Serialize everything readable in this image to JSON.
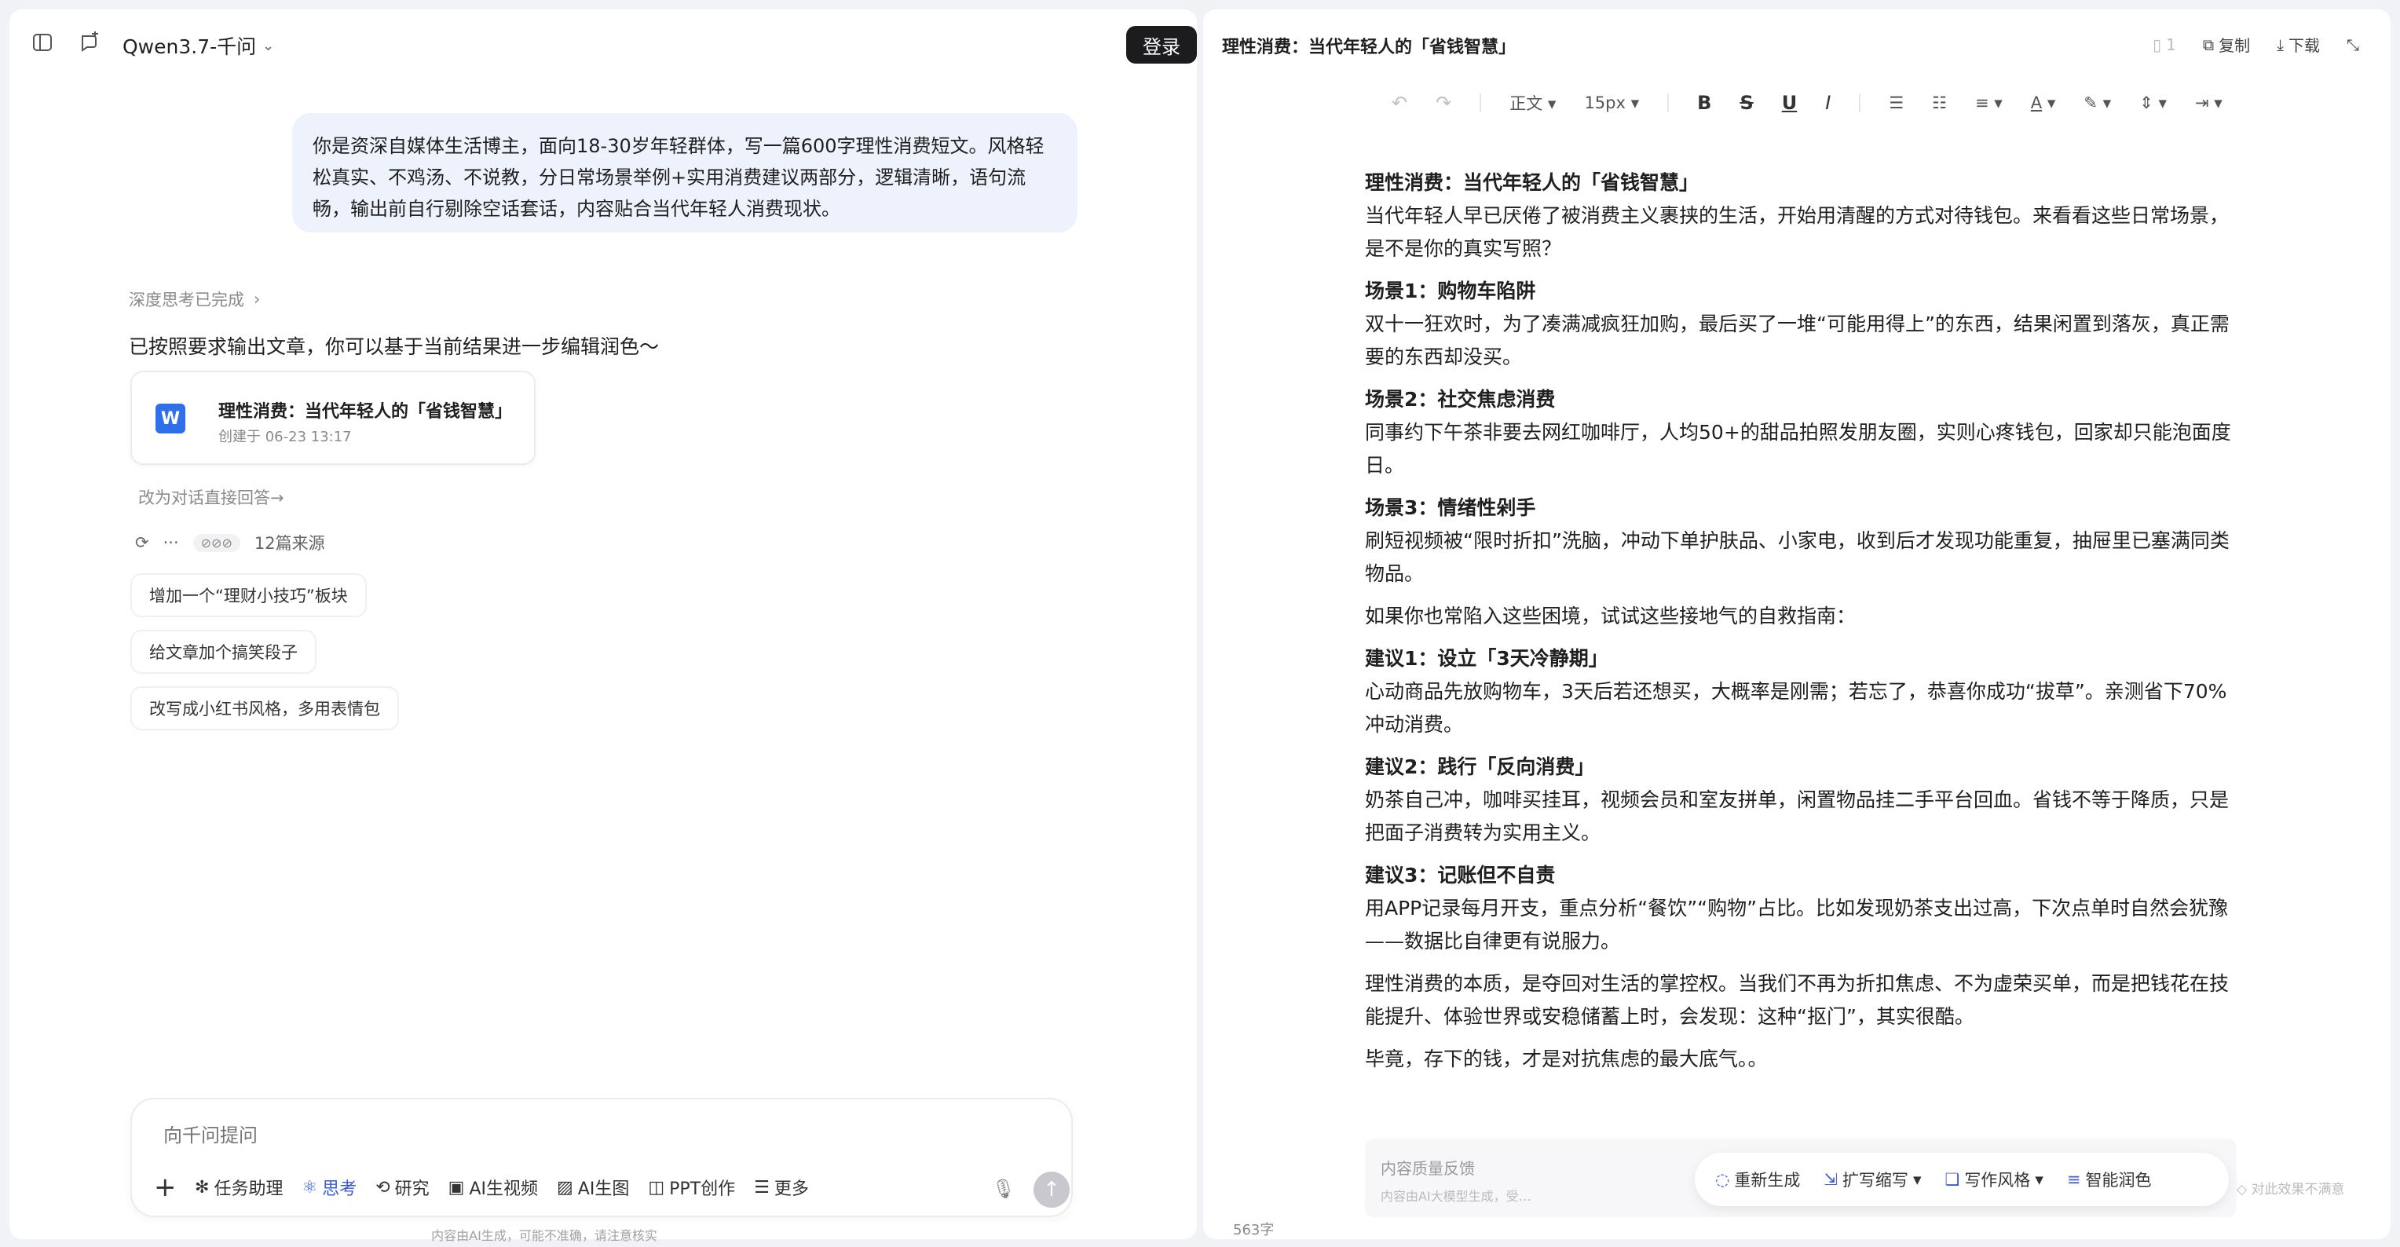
{
  "left": {
    "model_name": "Qwen3.7-千问",
    "login_label": "登录",
    "user_message": "你是资深自媒体生活博主，面向18-30岁年轻群体，写一篇600字理性消费短文。风格轻松真实、不鸡汤、不说教，分日常场景举例+实用消费建议两部分，逻辑清晰，语句流畅，输出前自行剔除空话套话，内容贴合当代年轻人消费现状。",
    "think_status": "深度思考已完成",
    "reply_text": "已按照要求输出文章，你可以基于当前结果进一步编辑润色～",
    "doc_card": {
      "icon_letter": "W",
      "title": "理性消费：当代年轻人的「省钱智慧」",
      "created": "创建于 06-23 13:17"
    },
    "switch_link": "改为对话直接回答→",
    "sources_label": "12篇来源",
    "more_label": "···",
    "suggestions": [
      "增加一个“理财小技巧”板块",
      "给文章加个搞笑段子",
      "改写成小红书风格，多用表情包"
    ],
    "composer": {
      "placeholder": "向千问提问",
      "tools": [
        {
          "label": "任务助理",
          "icon": "✻"
        },
        {
          "label": "思考",
          "icon": "⚛"
        },
        {
          "label": "研究",
          "icon": "⟲"
        },
        {
          "label": "AI生视频",
          "icon": "▣"
        },
        {
          "label": "AI生图",
          "icon": "▨"
        },
        {
          "label": "PPT创作",
          "icon": "◫"
        },
        {
          "label": "更多",
          "icon": "☰"
        }
      ]
    },
    "disclaimer": "内容由AI生成，可能不准确，请注意核实"
  },
  "right": {
    "title": "理性消费：当代年轻人的「省钱智慧」",
    "page_count": "1",
    "copy_label": "复制",
    "download_label": "下载",
    "toolbar": {
      "style_label": "正文",
      "size_label": "15px"
    },
    "doc": {
      "heading": "理性消费：当代年轻人的「省钱智慧」",
      "intro": "当代年轻人早已厌倦了被消费主义裹挟的生活，开始用清醒的方式对待钱包。来看看这些日常场景，是不是你的真实写照？",
      "s1_title": "场景1：购物车陷阱",
      "s1_body": "双十一狂欢时，为了凑满减疯狂加购，最后买了一堆“可能用得上”的东西，结果闲置到落灰，真正需要的东西却没买。",
      "s2_title": "场景2：社交焦虑消费",
      "s2_body": "同事约下午茶非要去网红咖啡厅，人均50+的甜品拍照发朋友圈，实则心疼钱包，回家却只能泡面度日。",
      "s3_title": "场景3：情绪性剁手",
      "s3_body": "刷短视频被“限时折扣”洗脑，冲动下单护肤品、小家电，收到后才发现功能重复，抽屉里已塞满同类物品。",
      "transition": "如果你也常陷入这些困境，试试这些接地气的自救指南：",
      "a1_title": "建议1：设立「3天冷静期」",
      "a1_body": "心动商品先放购物车，3天后若还想买，大概率是刚需；若忘了，恭喜你成功“拔草”。亲测省下70%冲动消费。",
      "a2_title": "建议2：践行「反向消费」",
      "a2_body": "奶茶自己冲，咖啡买挂耳，视频会员和室友拼单，闲置物品挂二手平台回血。省钱不等于降质，只是把面子消费转为实用主义。",
      "a3_title": "建议3：记账但不自责",
      "a3_body": "用APP记录每月开支，重点分析“餐饮”“购物”占比。比如发现奶茶支出过高，下次点单时自然会犹豫——数据比自律更有说服力。",
      "conclusion": "理性消费的本质，是夺回对生活的掌控权。当我们不再为折扣焦虑、不为虚荣买单，而是把钱花在技能提升、体验世界或安稳储蓄上时，会发现：这种“抠门”，其实很酷。",
      "ending": "毕竟，存下的钱，才是对抗焦虑的最大底气。。"
    },
    "feedback": {
      "title": "内容质量反馈",
      "sub": "内容由AI大模型生成，受…",
      "regenerate": "重新生成",
      "expand": "扩写缩写",
      "style": "写作风格",
      "polish": "智能润色",
      "unhappy": "对此效果不满意"
    },
    "word_count": "563字"
  }
}
